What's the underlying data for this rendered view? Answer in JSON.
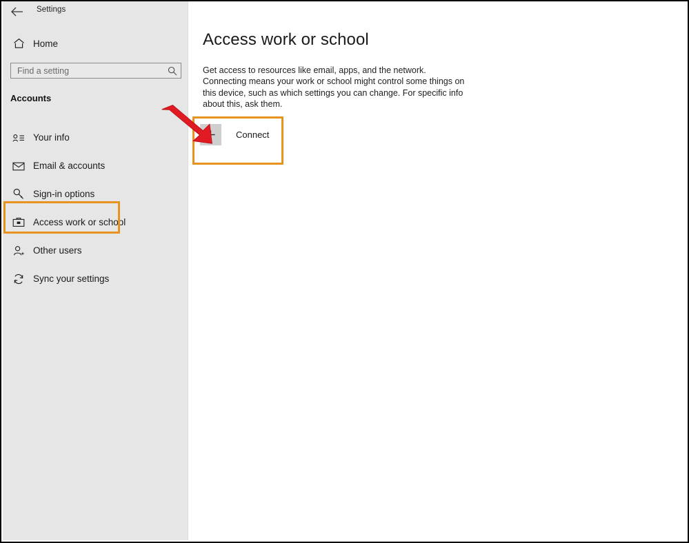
{
  "window": {
    "app_title": "Settings",
    "back_icon": "back-arrow-icon"
  },
  "sidebar": {
    "home": {
      "label": "Home",
      "icon": "home-icon"
    },
    "search": {
      "value": "",
      "placeholder": "Find a setting",
      "icon": "search-icon"
    },
    "section_header": "Accounts",
    "items": [
      {
        "label": "Your info",
        "icon": "person-card-icon",
        "selected": false
      },
      {
        "label": "Email & accounts",
        "icon": "envelope-icon",
        "selected": false
      },
      {
        "label": "Sign-in options",
        "icon": "key-icon",
        "selected": false
      },
      {
        "label": "Access work or school",
        "icon": "briefcase-icon",
        "selected": true
      },
      {
        "label": "Other users",
        "icon": "person-add-icon",
        "selected": false
      },
      {
        "label": "Sync your settings",
        "icon": "sync-icon",
        "selected": false
      }
    ]
  },
  "main": {
    "title": "Access work or school",
    "description": "Get access to resources like email, apps, and the network. Connecting means your work or school might control some things on this device, such as which settings you can change. For specific info about this, ask them.",
    "connect_button": {
      "label": "Connect",
      "icon": "plus-icon"
    }
  },
  "annotations": {
    "highlight_color": "#e8921f",
    "arrow_color": "#e01b24",
    "highlight_sidebar_target": "Access work or school",
    "highlight_connect_target": "Connect",
    "arrow_points_to": "Connect"
  }
}
